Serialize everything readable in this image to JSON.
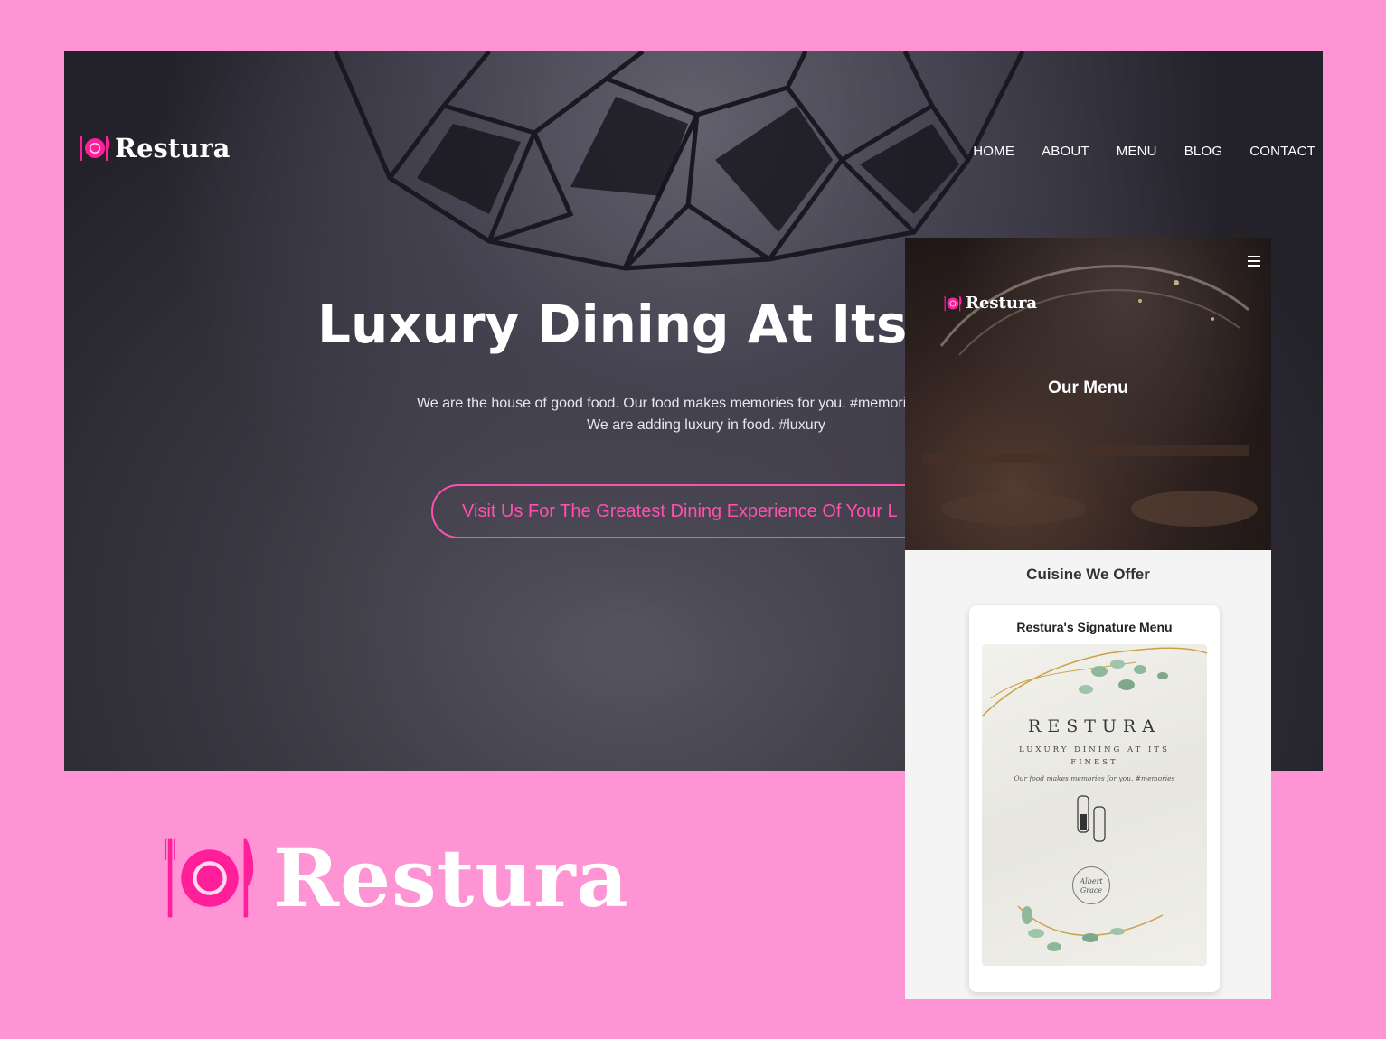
{
  "brand": {
    "name": "Restura"
  },
  "desktop": {
    "nav": [
      "HOME",
      "ABOUT",
      "MENU",
      "BLOG",
      "CONTACT"
    ],
    "hero_title": "Luxury Dining At Its",
    "hero_sub_line1": "We are the house of good food. Our food makes memories for you. #memories Spent your",
    "hero_sub_line2": "We are adding luxury in food. #luxury",
    "cta": "Visit Us For The Greatest Dining Experience Of Your L"
  },
  "mobile": {
    "heading": "Our Menu",
    "section_title": "Cuisine We Offer",
    "card_title": "Restura's Signature Menu",
    "menu_brand": "RESTURA",
    "menu_tagline": "LUXURY DINING AT ITS FINEST",
    "menu_note": "Our food makes memories for you. #memories",
    "menu_stamp": "Albert Grace"
  },
  "colors": {
    "background": "#ff94d4",
    "accent": "#ff1f9b",
    "cta": "#ff4fb0"
  },
  "icons": {
    "logo": "plate-fork-knife-icon",
    "menu": "hamburger-icon"
  }
}
